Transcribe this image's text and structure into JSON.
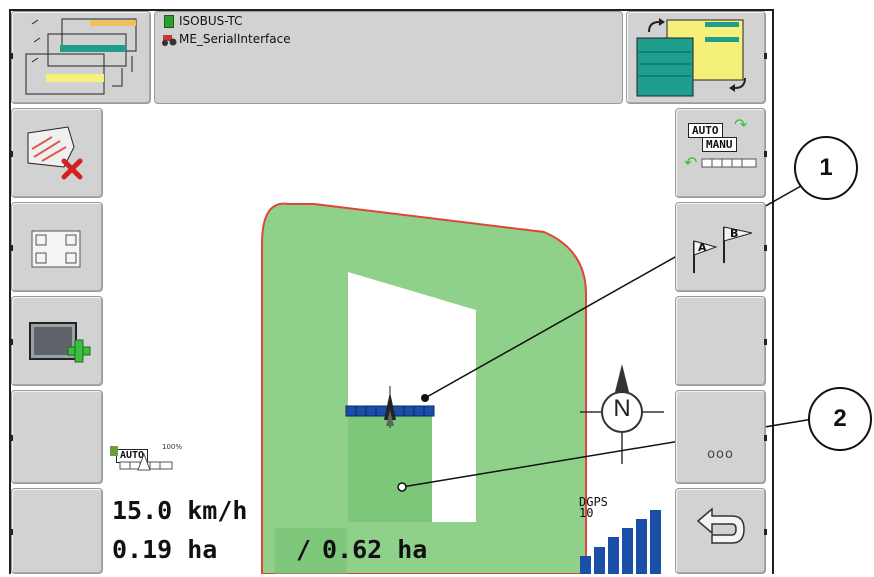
{
  "header": {
    "line1": "ISOBUS-TC",
    "line2": "ME_SerialInterface"
  },
  "map": {
    "compass_label": "N",
    "auto_badge": "AUTO",
    "auto_percent": "100%"
  },
  "readouts": {
    "speed": "15.0 km/h",
    "area_worked": "0.19 ha",
    "area_separator": "/",
    "area_total": "0.62 ha"
  },
  "gps": {
    "label": "DGPS",
    "value": "10",
    "signal_bars": 6
  },
  "buttons": {
    "auto_manu_top": "AUTO",
    "auto_manu_bottom": "MANU",
    "ab_left": "A",
    "ab_right": "B",
    "more_label": "ooo"
  },
  "callouts": [
    "1",
    "2"
  ],
  "colors": {
    "field_fill": "#8fd18a",
    "field_border": "#e0443a",
    "button_gray": "#d2d2d2",
    "teal": "#1f9e8e",
    "yellow": "#f4f07a",
    "bar_blue": "#1a4fa8"
  }
}
